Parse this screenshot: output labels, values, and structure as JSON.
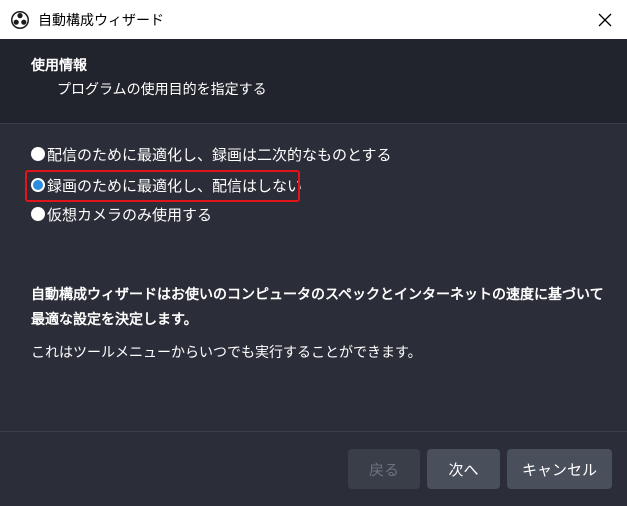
{
  "window": {
    "title": "自動構成ウィザード",
    "app_icon": "obs-logo-icon",
    "close_icon": "close-icon"
  },
  "header": {
    "title": "使用情報",
    "subtitle": "プログラムの使用目的を指定する"
  },
  "options": [
    {
      "label": "配信のために最適化し、録画は二次的なものとする",
      "selected": false
    },
    {
      "label": "録画のために最適化し、配信はしない",
      "selected": true
    },
    {
      "label": "仮想カメラのみ使用する",
      "selected": false
    }
  ],
  "description": {
    "line1": "自動構成ウィザードはお使いのコンピュータのスペックとインターネットの速度に基づいて最適な設定を決定します。",
    "line2": "これはツールメニューからいつでも実行することができます。"
  },
  "buttons": {
    "back": "戻る",
    "next": "次へ",
    "cancel": "キャンセル"
  },
  "colors": {
    "accent": "#2a8de0",
    "highlight": "#e0151b",
    "background": "#2b2e38"
  }
}
